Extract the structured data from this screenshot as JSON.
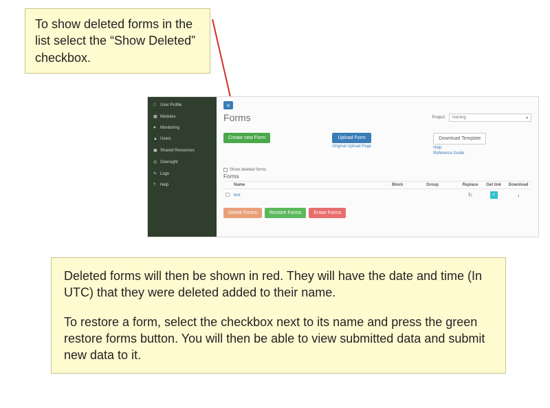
{
  "callouts": {
    "top": "To show deleted forms in the list select the “Show Deleted” checkbox.",
    "bottom1": "Deleted forms will then be shown in red.  They will have the date and time (In UTC) that they were deleted added to their name.",
    "bottom2": "To restore a form, select the checkbox next to its name and press the green restore forms button.  You will then be able to view submitted data and submit new data to it."
  },
  "sidebar": {
    "items": [
      {
        "icon": "□",
        "label": "User Profile"
      },
      {
        "icon": "▦",
        "label": "Modules"
      },
      {
        "icon": "♥",
        "label": "Monitoring"
      },
      {
        "icon": "▲",
        "label": "Users"
      },
      {
        "icon": "▣",
        "label": "Shared Resources"
      },
      {
        "icon": "◎",
        "label": "Oversight"
      },
      {
        "icon": "✎",
        "label": "Logs"
      },
      {
        "icon": "?",
        "label": "Help"
      }
    ]
  },
  "page": {
    "menu_glyph": "≡",
    "title": "Forms",
    "project_label": "Project",
    "project_value": "training",
    "project_caret": "▾"
  },
  "buttons": {
    "create": "Create new Form",
    "upload": "Upload Form",
    "orig_upload": "Original Upload Page",
    "download_template": "Download Template",
    "help_link": "Help",
    "ref_guide": "Reference Guide"
  },
  "show_deleted_label": "Show deleted forms",
  "forms_section_title": "Forms",
  "table": {
    "headers": {
      "name": "Name",
      "block": "Block",
      "group": "Group",
      "replace": "Replace",
      "getlink": "Get link",
      "download": "Download"
    },
    "rows": [
      {
        "name": "test",
        "block": "",
        "group": "",
        "replace_glyph": "↻",
        "share_glyph": "<",
        "download_glyph": "↓"
      }
    ]
  },
  "actions": {
    "delete": "Delete Forms",
    "restore": "Restore Forms",
    "erase": "Erase Forms"
  }
}
